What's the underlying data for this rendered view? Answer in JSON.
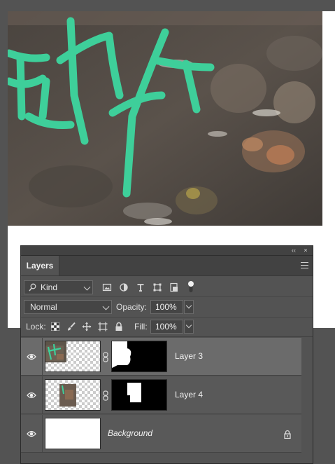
{
  "panel": {
    "tab_label": "Layers",
    "collapse_glyph": "‹‹",
    "close_glyph": "×"
  },
  "filter": {
    "kind_label": "Kind",
    "icons": [
      "image-filter-icon",
      "adjustment-filter-icon",
      "type-filter-icon",
      "shape-filter-icon",
      "smart-object-filter-icon",
      "filter-toggle-icon"
    ]
  },
  "blend": {
    "mode": "Normal",
    "opacity_label": "Opacity:",
    "opacity_value": "100%"
  },
  "lock": {
    "label": "Lock:",
    "icons": [
      "lock-transparent-pixels-icon",
      "lock-image-pixels-icon",
      "lock-position-icon",
      "lock-artboard-icon",
      "lock-all-icon"
    ],
    "fill_label": "Fill:",
    "fill_value": "100%"
  },
  "layers": [
    {
      "name": "Layer 3",
      "visible": true,
      "selected": true,
      "has_mask": true
    },
    {
      "name": "Layer 4",
      "visible": true,
      "selected": false,
      "has_mask": true
    },
    {
      "name": "Background",
      "visible": true,
      "selected": false,
      "locked": true
    }
  ],
  "colors": {
    "panel_bg": "#535353",
    "selected_row": "#6b6b6b",
    "graffiti_green": "#3ecf9a"
  }
}
